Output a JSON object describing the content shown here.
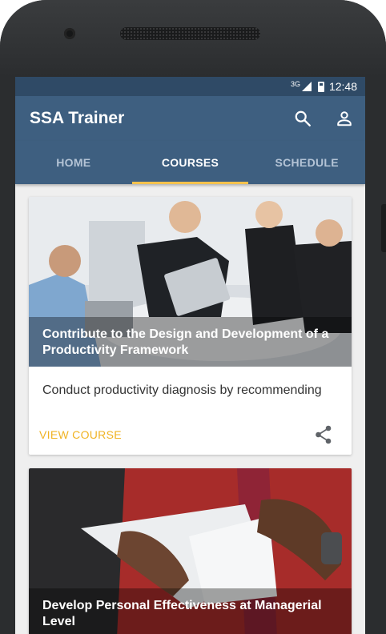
{
  "status_bar": {
    "network": "3G",
    "time": "12:48"
  },
  "app_bar": {
    "title": "SSA Trainer",
    "search_icon": "search-icon",
    "account_icon": "person-icon"
  },
  "tabs": [
    {
      "label": "HOME",
      "active": false
    },
    {
      "label": "COURSES",
      "active": true
    },
    {
      "label": "SCHEDULE",
      "active": false
    }
  ],
  "courses": [
    {
      "title": "Contribute to the Design and Development of a Productivity Framework",
      "description": "Conduct productivity diagnosis by recommending",
      "action_label": "VIEW COURSE",
      "share_icon": "share-icon"
    },
    {
      "title": "Develop Personal Effectiveness at Managerial Level"
    }
  ],
  "colors": {
    "primary": "#3e5f80",
    "status_bar": "#2f4a66",
    "accent": "#f0b323",
    "tab_indicator": "#f4c24d"
  }
}
